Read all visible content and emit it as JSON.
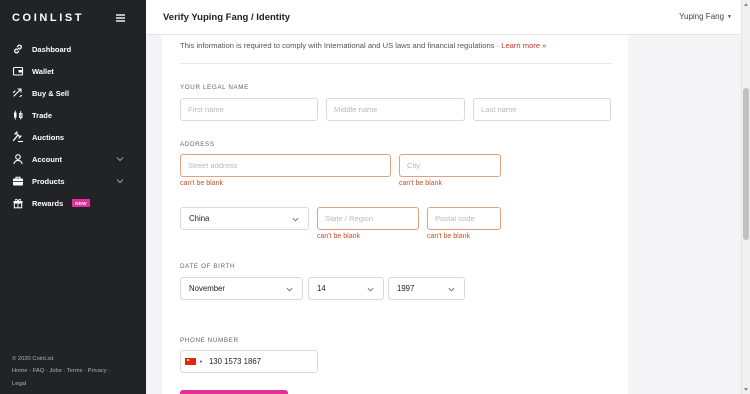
{
  "app": {
    "logo": "COINLIST"
  },
  "sidebar": {
    "items": [
      {
        "label": "Dashboard",
        "icon": "link-icon"
      },
      {
        "label": "Wallet",
        "icon": "wallet-icon"
      },
      {
        "label": "Buy & Sell",
        "icon": "exchange-icon"
      },
      {
        "label": "Trade",
        "icon": "candlestick-icon"
      },
      {
        "label": "Auctions",
        "icon": "gavel-icon"
      },
      {
        "label": "Account",
        "icon": "user-icon",
        "expandable": true
      },
      {
        "label": "Products",
        "icon": "briefcase-icon",
        "expandable": true
      },
      {
        "label": "Rewards",
        "icon": "gift-icon",
        "badge": "NEW"
      }
    ],
    "footer": {
      "copyright": "© 2020 CoinList",
      "links": [
        "Home",
        "FAQ",
        "Jobs",
        "Terms",
        "Privacy",
        "Legal"
      ]
    }
  },
  "header": {
    "title": "Verify Yuping Fang / Identity",
    "user": "Yuping Fang"
  },
  "form": {
    "info_text": "This information is required to comply with International and US laws and financial regulations · ",
    "info_link": "Learn more »",
    "legal_name": {
      "label": "YOUR LEGAL NAME",
      "first_placeholder": "First name",
      "middle_placeholder": "Middle name",
      "last_placeholder": "Last name"
    },
    "address": {
      "label": "ADDRESS",
      "street_placeholder": "Street address",
      "city_placeholder": "City",
      "country": "China",
      "region_placeholder": "State / Region",
      "postal_placeholder": "Postal code",
      "error": "can't be blank"
    },
    "dob": {
      "label": "DATE OF BIRTH",
      "month": "November",
      "day": "14",
      "year": "1997"
    },
    "phone": {
      "label": "PHONE NUMBER",
      "value": "130 1573 1867",
      "country_flag": "china-flag-icon"
    }
  },
  "colors": {
    "sidebar_bg": "#222326",
    "accent": "#e0319a",
    "error": "#c0512b",
    "link": "#c0392b"
  }
}
